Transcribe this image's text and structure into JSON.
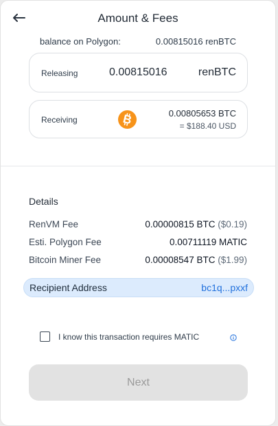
{
  "header": {
    "title": "Amount & Fees",
    "back_icon": "arrow-left-icon"
  },
  "balance": {
    "label": "balance on Polygon:",
    "value": "0.00815016 renBTC"
  },
  "releasing": {
    "label": "Releasing",
    "amount": "0.00815016",
    "currency": "renBTC"
  },
  "receiving": {
    "label": "Receiving",
    "icon": "bitcoin-icon",
    "amount": "0.00805653 BTC",
    "usd": "= $188.40 USD"
  },
  "details": {
    "title": "Details",
    "fees": [
      {
        "label": "RenVM Fee",
        "value": "0.00000815 BTC",
        "usd": "($0.19)"
      },
      {
        "label": "Esti. Polygon Fee",
        "value": "0.00711119 MATIC",
        "usd": ""
      },
      {
        "label": "Bitcoin Miner Fee",
        "value": "0.00008547 BTC",
        "usd": "($1.99)"
      }
    ]
  },
  "recipient": {
    "label": "Recipient Address",
    "value": "bc1q...pxxf"
  },
  "agreement": {
    "label": "I know this transaction requires MATIC",
    "checked": false
  },
  "actions": {
    "next_label": "Next",
    "next_enabled": false
  },
  "colors": {
    "accent": "#1f6fdc",
    "bitcoin": "#f7931a",
    "recipient_bg": "#dcebfd",
    "button_disabled": "#e2e2e2"
  }
}
